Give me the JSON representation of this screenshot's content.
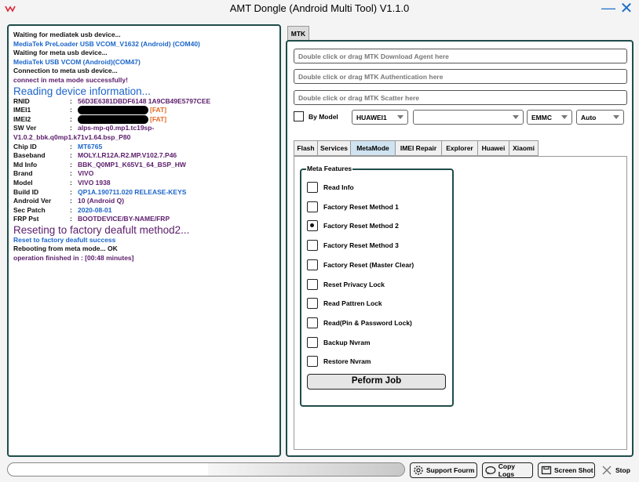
{
  "window": {
    "title": "AMT Dongle (Android Multi Tool) V1.1.0",
    "minimize_glyph": "—",
    "close_glyph": "✕"
  },
  "log": {
    "lines": [
      {
        "text": "Waiting for mediatek usb device...",
        "color": "black"
      },
      {
        "text": "MediaTek PreLoader USB VCOM_V1632 (Android) (COM40)",
        "color": "blue"
      },
      {
        "text": "Waiting for meta usb device...",
        "color": "black"
      },
      {
        "text": "MediaTek USB VCOM (Android)(COM47)",
        "color": "blue"
      },
      {
        "text": "Connection to meta usb device...",
        "color": "black"
      },
      {
        "text": "connect in meta mode successfully!",
        "color": "purple"
      }
    ],
    "reading_header": "Reading device information...",
    "fields": [
      {
        "key": "RNID",
        "value": "56D3E6381DBDF6148 1A9CB49E5797CEE"
      },
      {
        "key": "IMEI1",
        "value": "[FAT]",
        "redacted": true
      },
      {
        "key": "IMEI2",
        "value": "[FAT]",
        "redacted": true
      },
      {
        "key": "SW Ver",
        "value": "alps-mp-q0.mp1.tc19sp-"
      }
    ],
    "sw_ver_cont": "V1.0.2_bbk.q0mp1.k71v1.64.bsp_P80",
    "fields2": [
      {
        "key": "Chip ID",
        "value": "MT6765",
        "blue": true
      },
      {
        "key": "Baseband",
        "value": "MOLY.LR12A.R2.MP.V102.7.P46"
      },
      {
        "key": "Md Info",
        "value": "BBK_Q0MP1_K65V1_64_BSP_HW"
      },
      {
        "key": "Brand",
        "value": "VIVO"
      },
      {
        "key": "Model",
        "value": "VIVO 1938"
      },
      {
        "key": "Build ID",
        "value": "QP1A.190711.020 RELEASE-KEYS",
        "blue": true
      },
      {
        "key": "Android Ver",
        "value": "10 (Android Q)"
      },
      {
        "key": "Sec Patch",
        "value": "2020-08-01",
        "blue": true
      },
      {
        "key": "FRP Pst",
        "value": "BOOTDEVICE/BY-NAME/FRP"
      }
    ],
    "reset_header": "Reseting to factory deafult method2...",
    "reset_success": "Reset to factory deafult success",
    "reboot_text": "Rebooting from meta mode...",
    "reboot_ok": "OK",
    "finished": "operation finished in : [00:48 minutes]"
  },
  "right": {
    "main_tab": "MTK",
    "fields": [
      "Double click or drag MTK Download Agent here",
      "Double click or drag MTK Authentication here",
      "Double click or drag MTK Scatter here"
    ],
    "by_model_label": "By Model",
    "brand_select": "HUAWEI1",
    "model_select": "",
    "storage_select": "EMMC",
    "mode_select": "Auto",
    "tabs": [
      "Flash",
      "Services",
      "MetaMode",
      "IMEI Repair",
      "Explorer",
      "Huawei",
      "Xiaomi"
    ],
    "active_tab": "MetaMode",
    "meta_legend": "Meta Features",
    "options": [
      {
        "label": "Read Info",
        "checked": false
      },
      {
        "label": "Factory Reset Method 1",
        "checked": false
      },
      {
        "label": "Factory Reset Method 2",
        "checked": true
      },
      {
        "label": "Factory Reset Method 3",
        "checked": false
      },
      {
        "label": "Factory Reset (Master Clear)",
        "checked": false
      },
      {
        "label": "Reset Privacy Lock",
        "checked": false
      },
      {
        "label": "Read Pattren Lock",
        "checked": false
      },
      {
        "label": "Read(Pin & Password Lock)",
        "checked": false
      },
      {
        "label": "Backup Nvram",
        "checked": false
      },
      {
        "label": "Restore Nvram",
        "checked": false
      }
    ],
    "perform_label": "Peform Job"
  },
  "bottom": {
    "support": "Support Fourm",
    "copy_logs": "Copy Logs",
    "screen_shot": "Screen Shot",
    "stop": "Stop"
  },
  "colors": {
    "border": "#1f4d4a",
    "blue": "#1b65c9",
    "purple": "#5b1d6b",
    "fat": "#e66a22",
    "accent": "#1a6fc9"
  }
}
